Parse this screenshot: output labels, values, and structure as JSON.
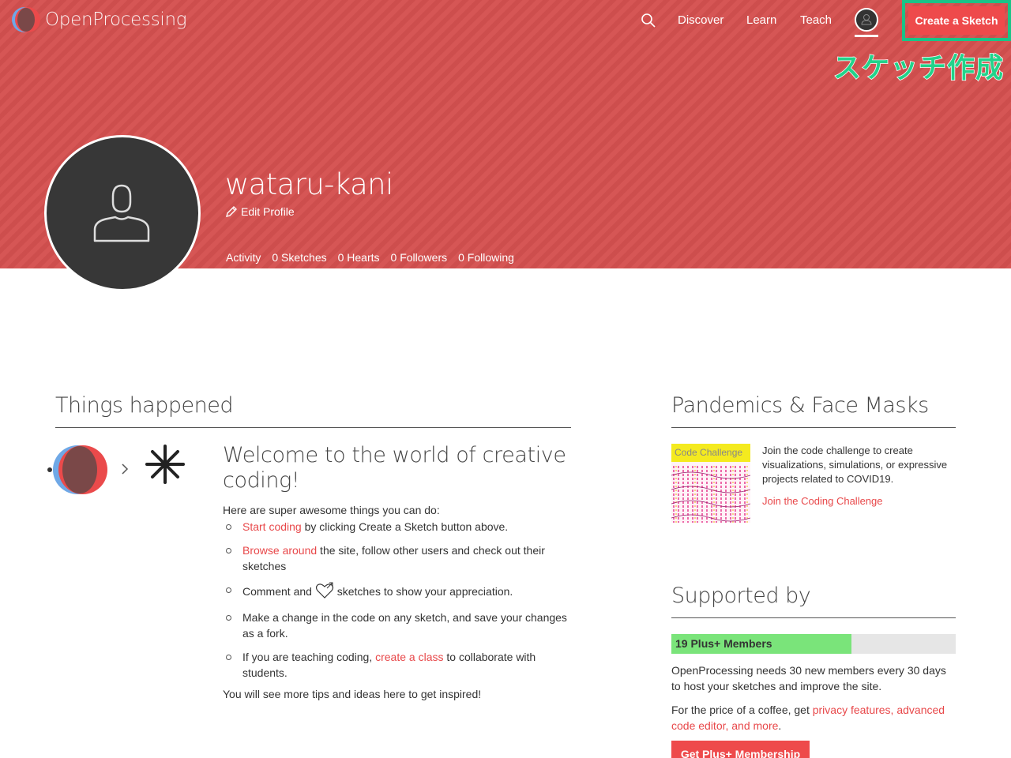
{
  "header": {
    "brand": "OpenProcessing",
    "nav": [
      "Discover",
      "Learn",
      "Teach"
    ],
    "create_button": "Create a Sketch",
    "annotation": "スケッチ作成"
  },
  "profile": {
    "username": "wataru-kani",
    "edit_label": "Edit Profile",
    "tabs": [
      "Activity",
      "0 Sketches",
      "0 Hearts",
      "0 Followers",
      "0 Following"
    ],
    "active_tab": "Activity"
  },
  "activity": {
    "heading": "Things happened",
    "welcome_title": "Welcome to the world of creative coding!",
    "intro": "Here are super awesome things you can do:",
    "tips": [
      {
        "link": "Start coding",
        "rest": " by clicking Create a Sketch button above."
      },
      {
        "link": "Browse around",
        "rest": " the site, follow other users and check out their sketches"
      },
      {
        "pre": "Comment and ",
        "post": " sketches to show your appreciation."
      },
      {
        "text": "Make a change in the code on any sketch, and save your changes as a fork."
      },
      {
        "pre": "If you are teaching coding, ",
        "link": "create a class",
        "rest": " to collaborate with students."
      }
    ],
    "outro": "You will see more tips and ideas here to get inspired!"
  },
  "challenge": {
    "heading": "Pandemics & Face Masks",
    "tag": "Code Challenge",
    "description": "Join the code challenge to create visualizations, simulations, or expressive projects related to COVID19.",
    "link": "Join the Coding Challenge"
  },
  "support": {
    "heading": "Supported by",
    "bar_label": "19 Plus+ Members",
    "progress": 0.633,
    "p1": "OpenProcessing needs 30 new members every 30 days to host your sketches and improve the site.",
    "p2_pre": "For the price of a coffee, get ",
    "p2_link": "privacy features, advanced code editor, and more",
    "p2_post": ".",
    "button": "Get Plus+ Membership"
  },
  "colors": {
    "banner": "#d4504f",
    "accent": "#ee4a4b",
    "link": "#e8484a",
    "highlight": "#19c487",
    "progress_fill": "#7ae47a"
  }
}
